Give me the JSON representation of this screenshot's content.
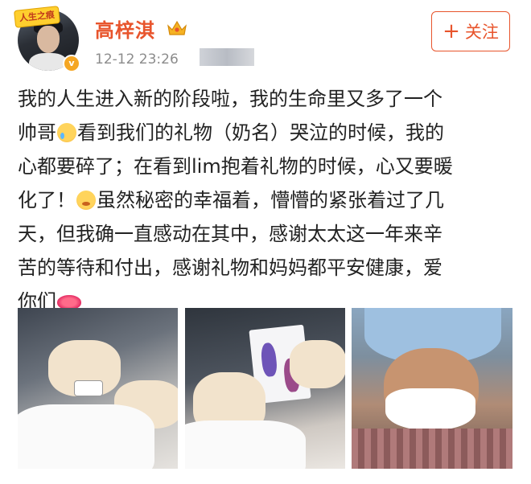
{
  "header": {
    "avatar_badge": "人生之痕",
    "username": "高梓淇",
    "timestamp": "12-12 23:26",
    "follow_label": "关注",
    "follow_icon": "plus-icon",
    "accent_color": "#e8542c"
  },
  "post": {
    "segments": [
      "我的人生进入新的阶段啦，我的生命里又多了一个\n帅哥",
      "看到我们的礼物（奶名）哭泣的时候，我的\n心都要碎了；在看到lim抱着礼物的时候，心又要暖\n化了！",
      "虽然秘密的幸福着，懵懵的紧张着过了几\n天，但我确一直感动在其中，感谢太太这一年来辛\n苦的等待和付出，感谢礼物和妈妈都平安健康，爱\n你们"
    ],
    "emojis": [
      "crying-face-icon",
      "touched-face-icon",
      "lips-icon"
    ]
  },
  "photos": [
    "baby-hand-photo",
    "footprint-card-photo",
    "father-in-mask-photo"
  ]
}
